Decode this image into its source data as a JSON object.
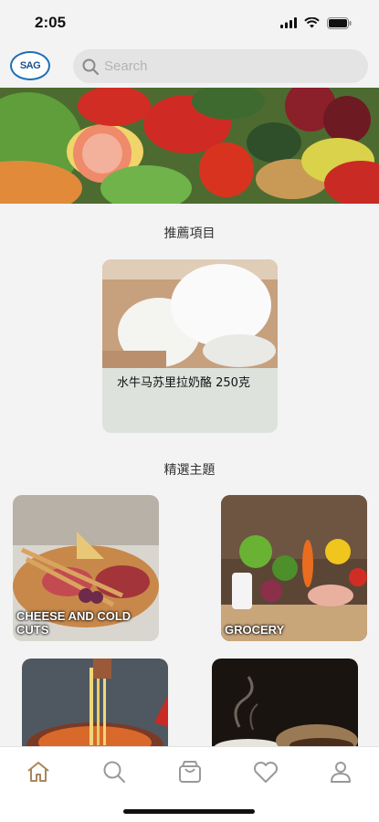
{
  "status_bar": {
    "time": "2:05"
  },
  "header": {
    "logo_text": "SAG",
    "search_placeholder": "Search"
  },
  "recommended": {
    "title": "推薦項目",
    "items": [
      {
        "name": "水牛马苏里拉奶酪 250克"
      }
    ]
  },
  "themes": {
    "title": "精選主題",
    "items": [
      {
        "label": "CHEESE AND COLD CUTS"
      },
      {
        "label": "GROCERY"
      },
      {
        "label": ""
      },
      {
        "label": ""
      }
    ]
  },
  "tab_bar": {
    "tabs": [
      {
        "icon": "home-icon",
        "active": true
      },
      {
        "icon": "search-icon",
        "active": false
      },
      {
        "icon": "cart-icon",
        "active": false
      },
      {
        "icon": "heart-icon",
        "active": false
      },
      {
        "icon": "profile-icon",
        "active": false
      }
    ],
    "active_color": "#a8875a",
    "inactive_color": "#999999"
  }
}
